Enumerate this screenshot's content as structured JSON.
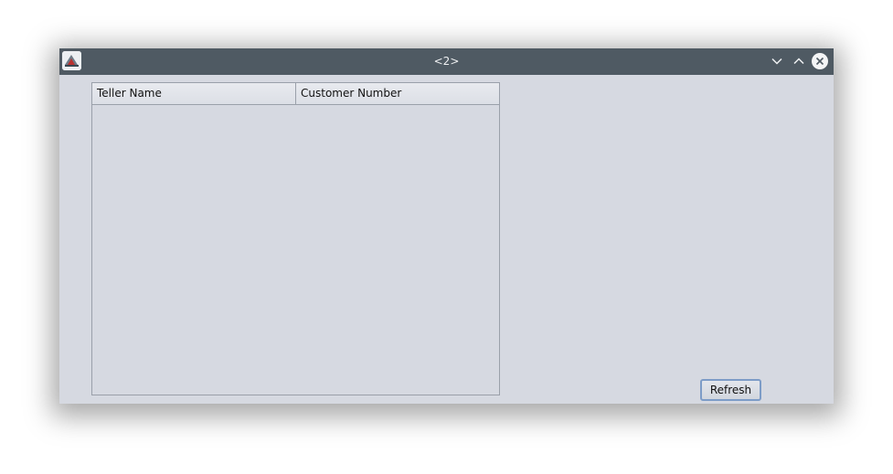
{
  "window": {
    "title": "<2>"
  },
  "titlebar": {
    "icons": [
      "app-icon",
      "minimize-icon",
      "maximize-icon",
      "close-icon"
    ]
  },
  "table": {
    "columns": [
      "Teller Name",
      "Customer Number"
    ],
    "rows": []
  },
  "buttons": {
    "refresh_label": "Refresh"
  },
  "colors": {
    "titlebar": "#4f5a63",
    "window_bg": "#d6d9e1",
    "button_focus_border": "#7d9cc7"
  }
}
